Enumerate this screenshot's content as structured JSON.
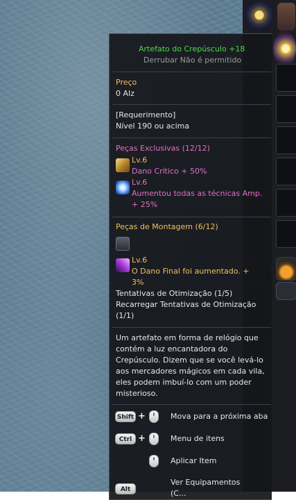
{
  "tooltip": {
    "item_name": "Artefato do Crepúsculo +18",
    "drop_note": "Derrubar Não é permitido",
    "price_label": "Preço",
    "price_value": "0 Alz",
    "requirement_label": "[Requerimento]",
    "requirement_value": "Nível 190 ou acima",
    "exclusive": {
      "header": "Peças Exclusivas (12/12)",
      "entries": [
        {
          "level": "Lv.6",
          "lines": [
            "Dano Crítico  + 50%"
          ]
        },
        {
          "level": "Lv.6",
          "lines": [
            "Aumentou todas as técnicas Amp.",
            "+ 25%"
          ]
        }
      ]
    },
    "assembly": {
      "header": "Peças de Montagem (6/12)",
      "entries": [
        {
          "level": "Lv.6",
          "lines": [
            "O Dano Final foi aumentado.  +",
            "3%"
          ]
        }
      ]
    },
    "optimization_attempts": "Tentativas de Otimização (1/5)",
    "recharge_lines": [
      "Recarregar Tentativas de Otimização",
      "(1/1)"
    ],
    "description_lines": [
      "Um artefato em forma de relógio que",
      "contém a luz encantadora do",
      "Crepúsculo. Dizem que se você levá-lo",
      "aos mercadores mágicos em cada vila,",
      " eles podem imbuí-lo com um poder",
      "misterioso."
    ],
    "hotkeys": [
      {
        "key": "Shift",
        "action": "Mova para a próxima aba"
      },
      {
        "key": "Ctrl",
        "action": "Menu de itens"
      },
      {
        "key": "",
        "action": "Aplicar Item"
      },
      {
        "key": "Alt",
        "action": "Ver Equipamentos"
      }
    ],
    "last_line_fragment": "(C..."
  },
  "colors": {
    "item_name": "#4cd94c",
    "gray": "#9a9a9a",
    "price": "#f0c060",
    "exclusive": "#e070c8",
    "assembly": "#f0c060",
    "text": "#e8e8e8"
  }
}
